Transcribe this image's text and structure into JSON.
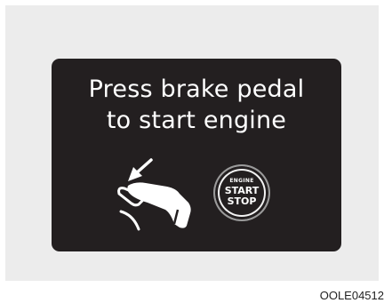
{
  "display": {
    "line1": "Press brake pedal",
    "line2": "to start engine"
  },
  "start_button": {
    "line1": "ENGINE",
    "line2": "START",
    "line3": "STOP"
  },
  "figure_code": "OOLE04512",
  "icons": [
    "brake-pedal-icon",
    "arrow-down-left-icon",
    "engine-start-stop-button-icon"
  ],
  "colors": {
    "display_background": "#231f20",
    "display_text": "#ffffff",
    "page_background": "#ececec"
  }
}
